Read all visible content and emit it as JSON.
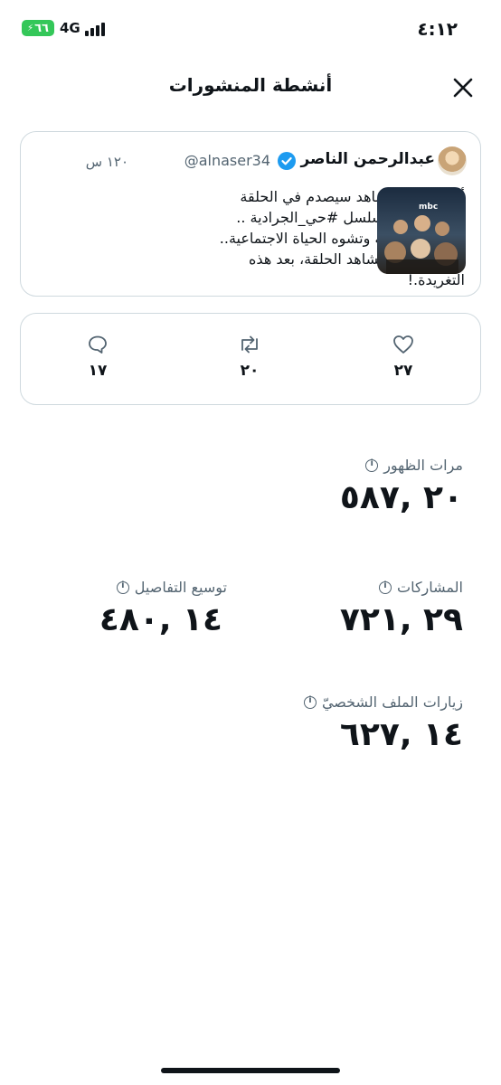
{
  "status_bar": {
    "time": "٤:١٢",
    "battery": "٦٦",
    "network": "4G"
  },
  "header": {
    "title": "أنشطة المنشورات",
    "close_icon": "close-icon"
  },
  "tweet": {
    "display_name": "عبدالرحمن الناصر",
    "handle": "@alnaser34",
    "time": "١٢٠ س",
    "text": "أعرف أن المشاهد سيصدم في الحلقة السابعة من مسلسل #حي_الجرادية .. الفكرة، مزعجة وتشوه الحياة الاجتماعية.. إذا لم تحذف مشاهد الحلقة، بعد هذه التغريدة.!",
    "media_label": "mbc"
  },
  "engagement": {
    "likes": "٢٧",
    "retweets": "٢٠",
    "replies": "١٧"
  },
  "stats": {
    "impressions": {
      "label": "مرات الظهور",
      "value": "٢٠ ,٥٨٧"
    },
    "shares": {
      "label": "المشاركات",
      "value": "٢٩ ,٧٢١"
    },
    "detail_expands": {
      "label": "توسيع التفاصيل",
      "value": "١٤ ,٤٨٠"
    },
    "profile_visits": {
      "label": "زيارات الملف الشخصيّ",
      "value": "١٤ ,٦٢٧"
    }
  },
  "colors": {
    "accent": "#1d9bf0",
    "border": "#cfd9de",
    "muted": "#536471",
    "battery": "#34c759"
  }
}
